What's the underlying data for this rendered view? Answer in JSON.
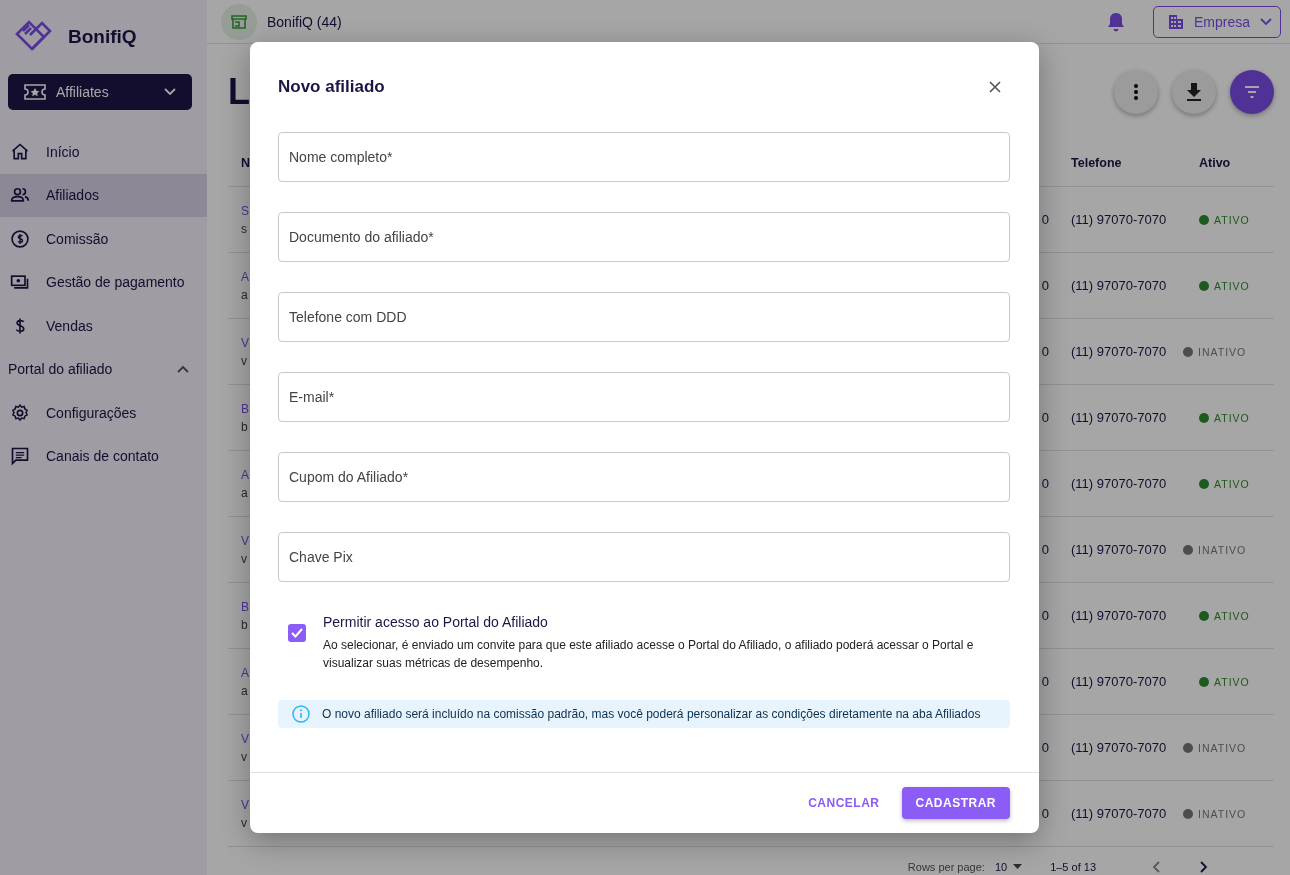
{
  "sidebar": {
    "brand": "BonifiQ",
    "product_switch": {
      "label": "Affiliates",
      "expanded": false
    },
    "items": [
      {
        "label": "Início",
        "selected": false
      },
      {
        "label": "Afiliados",
        "selected": true
      },
      {
        "label": "Comissão",
        "selected": false
      },
      {
        "label": "Gestão de pagamento",
        "selected": false
      },
      {
        "label": "Vendas",
        "selected": false
      }
    ],
    "section": {
      "label": "Portal do afiliado",
      "expanded": true,
      "items": [
        {
          "label": "Configurações",
          "selected": false
        },
        {
          "label": "Canais de contato",
          "selected": false
        }
      ]
    }
  },
  "topbar": {
    "store": "BonifiQ (44)",
    "company_button": "Empresa"
  },
  "page": {
    "title": "L"
  },
  "table": {
    "columns": [
      "N",
      "Telefone",
      "Ativo"
    ],
    "rows": [
      {
        "name": "S",
        "email": "s",
        "column_3": "0",
        "phone": "(11) 97070-7070",
        "status": "ATIVO",
        "active": true
      },
      {
        "name": "A",
        "email": "a",
        "column_3": "0",
        "phone": "(11) 97070-7070",
        "status": "ATIVO",
        "active": true
      },
      {
        "name": "V",
        "email": "v",
        "column_3": "0",
        "phone": "(11) 97070-7070",
        "status": "INATIVO",
        "active": false
      },
      {
        "name": "B",
        "email": "b",
        "column_3": "0",
        "phone": "(11) 97070-7070",
        "status": "ATIVO",
        "active": true
      },
      {
        "name": "A",
        "email": "a",
        "column_3": "0",
        "phone": "(11) 97070-7070",
        "status": "ATIVO",
        "active": true
      },
      {
        "name": "V",
        "email": "v",
        "column_3": "0",
        "phone": "(11) 97070-7070",
        "status": "INATIVO",
        "active": false
      },
      {
        "name": "B",
        "email": "b",
        "column_3": "0",
        "phone": "(11) 97070-7070",
        "status": "ATIVO",
        "active": true
      },
      {
        "name": "A",
        "email": "a",
        "column_3": "0",
        "phone": "(11) 97070-7070",
        "status": "ATIVO",
        "active": true
      },
      {
        "name": "V",
        "email": "v",
        "column_3": "0",
        "phone": "(11) 97070-7070",
        "status": "INATIVO",
        "active": false
      },
      {
        "name": "V",
        "email": "v",
        "column_3": "0",
        "phone": "(11) 97070-7070",
        "status": "INATIVO",
        "active": false
      }
    ]
  },
  "pagination": {
    "rows_per_page_label": "Rows per page:",
    "rows_per_page": "10",
    "range": "1–5 of 13"
  },
  "modal": {
    "title": "Novo afiliado",
    "fields": [
      {
        "placeholder": "Nome completo*"
      },
      {
        "placeholder": "Documento do afiliado*"
      },
      {
        "placeholder": "Telefone com DDD"
      },
      {
        "placeholder": "E-mail*"
      },
      {
        "placeholder": "Cupom do Afiliado*"
      },
      {
        "placeholder": "Chave Pix"
      }
    ],
    "checkbox": {
      "label": "Permitir acesso ao Portal do Afiliado",
      "description": "Ao selecionar, é enviado um convite para que este afiliado acesse o Portal do Afiliado, o afiliado poderá acessar o Portal e visualizar suas métricas de desempenho.",
      "checked": true
    },
    "info": "O novo afiliado será incluído na comissão padrão, mas você poderá personalizar as condições diretamente na aba Afiliados",
    "buttons": {
      "cancel": "CANCELAR",
      "submit": "CADASTRAR"
    }
  }
}
